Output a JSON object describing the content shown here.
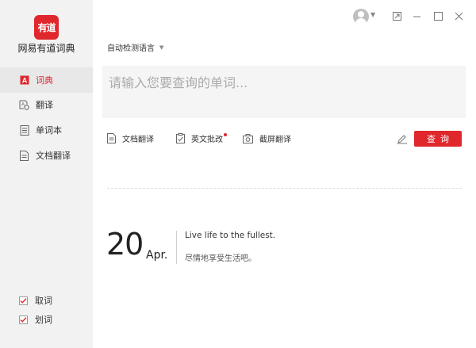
{
  "app": {
    "logo_text": "有道",
    "name": "网易有道词典"
  },
  "sidebar": {
    "items": [
      {
        "label": "词典",
        "active": true
      },
      {
        "label": "翻译",
        "active": false
      },
      {
        "label": "单词本",
        "active": false
      },
      {
        "label": "文档翻译",
        "active": false
      }
    ],
    "toggles": [
      {
        "label": "取词",
        "checked": true
      },
      {
        "label": "划词",
        "checked": true
      }
    ]
  },
  "header": {
    "language_selector": "自动检测语言"
  },
  "search": {
    "placeholder": "请输入您要查询的单词...",
    "value": "",
    "button_label": "查询"
  },
  "tools": {
    "doc_translate": "文档翻译",
    "english_correct": "英文批改",
    "screenshot_translate": "截屏翻译"
  },
  "daily": {
    "day": "20",
    "month": "Apr.",
    "quote_en": "Live life to the fullest.",
    "quote_cn": "尽情地享受生活吧。"
  },
  "colors": {
    "accent": "#e0272c",
    "sidebar_bg": "#f2f2f2",
    "search_bg": "#f5f5f5"
  }
}
